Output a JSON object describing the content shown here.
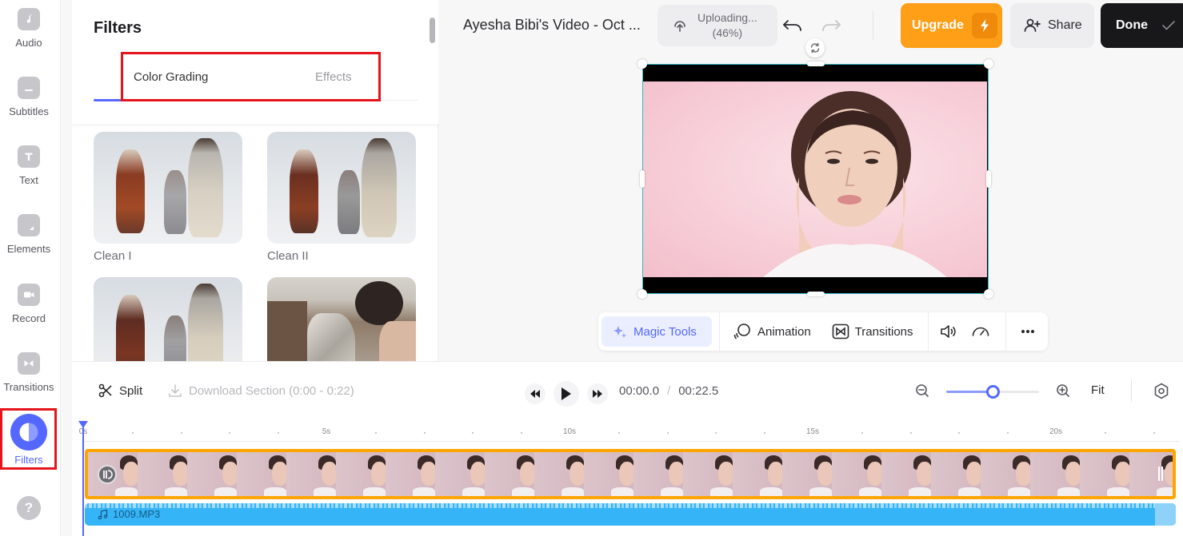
{
  "rail": {
    "items": [
      {
        "id": "audio",
        "label": "Audio",
        "icon": "music-note-icon"
      },
      {
        "id": "subtitles",
        "label": "Subtitles",
        "icon": "subtitles-icon"
      },
      {
        "id": "text",
        "label": "Text",
        "icon": "text-icon"
      },
      {
        "id": "elements",
        "label": "Elements",
        "icon": "elements-icon"
      },
      {
        "id": "record",
        "label": "Record",
        "icon": "camera-icon"
      },
      {
        "id": "transitions",
        "label": "Transitions",
        "icon": "transitions-icon"
      },
      {
        "id": "filters",
        "label": "Filters",
        "icon": "filters-icon",
        "active": true
      }
    ],
    "help_icon": "?"
  },
  "panel": {
    "title": "Filters",
    "tabs": [
      {
        "label": "Color Grading",
        "active": true
      },
      {
        "label": "Effects",
        "active": false
      }
    ],
    "filters": [
      {
        "label": "Clean I"
      },
      {
        "label": "Clean II"
      },
      {
        "label": ""
      },
      {
        "label": ""
      }
    ]
  },
  "topbar": {
    "title": "Ayesha Bibi's Video - Oct ...",
    "upload_status": "Uploading...",
    "upload_percent": "(46%)",
    "upload_progress": 0.46,
    "upgrade_label": "Upgrade",
    "share_label": "Share",
    "done_label": "Done"
  },
  "toolbar": {
    "magic_tools": "Magic Tools",
    "animation": "Animation",
    "transitions": "Transitions"
  },
  "timeline": {
    "split_label": "Split",
    "download_label": "Download Section (0:00 - 0:22)",
    "current_time": "00:00.0",
    "separator": "/",
    "total_time": "00:22.5",
    "fit_label": "Fit",
    "zoom_level": 0.5,
    "ruler": {
      "labels": [
        "0s",
        "5s",
        "10s",
        "15s",
        "20s"
      ],
      "label_seconds": [
        0,
        5,
        10,
        15,
        20
      ],
      "max_seconds": 22.5
    },
    "audio_track_label": "1009.MP3",
    "video_frame_count": 22
  },
  "colors": {
    "accent": "#5468ff",
    "upgrade": "#ff9f17",
    "done": "#18181b",
    "video_track_border": "#ffa500",
    "audio_track": "#35b5f7",
    "highlight_box": "#e5141b"
  }
}
